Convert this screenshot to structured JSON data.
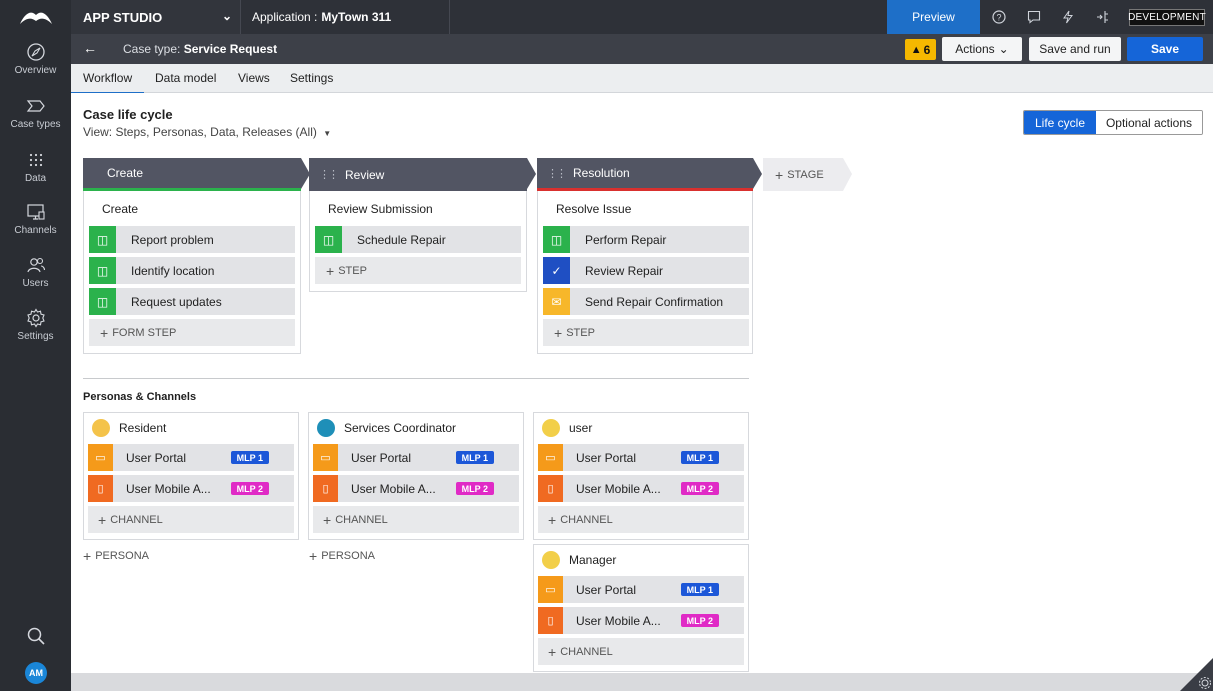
{
  "topbar": {
    "app_studio": "APP STUDIO",
    "application_label": "Application :",
    "application_name": "MyTown 311",
    "preview": "Preview",
    "environment": "DEVELOPMENT"
  },
  "leftnav": {
    "items": [
      {
        "label": "Overview",
        "icon": "compass-icon"
      },
      {
        "label": "Case types",
        "icon": "chevron-tag-icon"
      },
      {
        "label": "Data",
        "icon": "grid-dots-icon"
      },
      {
        "label": "Channels",
        "icon": "monitor-icon"
      },
      {
        "label": "Users",
        "icon": "users-icon"
      },
      {
        "label": "Settings",
        "icon": "gear-icon"
      }
    ],
    "avatar_initials": "AM"
  },
  "casebar": {
    "label": "Case type:",
    "name": "Service Request",
    "warnings": "6",
    "actions": "Actions",
    "save_and_run": "Save and run",
    "save": "Save"
  },
  "tabs": [
    "Workflow",
    "Data model",
    "Views",
    "Settings"
  ],
  "lifecycle": {
    "title": "Case life cycle",
    "view": "View: Steps, Personas, Data, Releases (All)",
    "toggle_lifecycle": "Life cycle",
    "toggle_optional": "Optional actions",
    "add_stage": "STAGE",
    "stages": [
      {
        "name": "Create",
        "process": "Create",
        "steps": [
          {
            "label": "Report problem",
            "kind": "form"
          },
          {
            "label": "Identify location",
            "kind": "form"
          },
          {
            "label": "Request updates",
            "kind": "form"
          }
        ],
        "add_label": "FORM STEP"
      },
      {
        "name": "Review",
        "process": "Review Submission",
        "steps": [
          {
            "label": "Schedule Repair",
            "kind": "form"
          }
        ],
        "add_label": "STEP"
      },
      {
        "name": "Resolution",
        "process": "Resolve Issue",
        "steps": [
          {
            "label": "Perform Repair",
            "kind": "form"
          },
          {
            "label": "Review Repair",
            "kind": "approval"
          },
          {
            "label": "Send Repair Confirmation",
            "kind": "email"
          }
        ],
        "add_label": "STEP"
      }
    ]
  },
  "personas": {
    "title": "Personas & Channels",
    "add_persona": "PERSONA",
    "add_channel": "CHANNEL",
    "cards": [
      {
        "name": "Resident",
        "channels": [
          {
            "label": "User Portal",
            "release": "MLP 1"
          },
          {
            "label": "User Mobile A...",
            "release": "MLP 2"
          }
        ]
      },
      {
        "name": "Services Coordinator",
        "channels": [
          {
            "label": "User Portal",
            "release": "MLP 1"
          },
          {
            "label": "User Mobile A...",
            "release": "MLP 2"
          }
        ]
      },
      {
        "name": "user",
        "channels": [
          {
            "label": "User Portal",
            "release": "MLP 1"
          },
          {
            "label": "User Mobile A...",
            "release": "MLP 2"
          }
        ]
      },
      {
        "name": "Manager",
        "channels": [
          {
            "label": "User Portal",
            "release": "MLP 1"
          },
          {
            "label": "User Mobile A...",
            "release": "MLP 2"
          }
        ]
      }
    ]
  },
  "colors": {
    "accent": "#1565d8",
    "form_step": "#2bb24c",
    "approval_step": "#1f4fc3",
    "email_step": "#f7b72a",
    "portal_channel": "#f59a1a",
    "mobile_channel": "#f06a21",
    "mlp1": "#1c57d8",
    "mlp2": "#e02ac6"
  }
}
